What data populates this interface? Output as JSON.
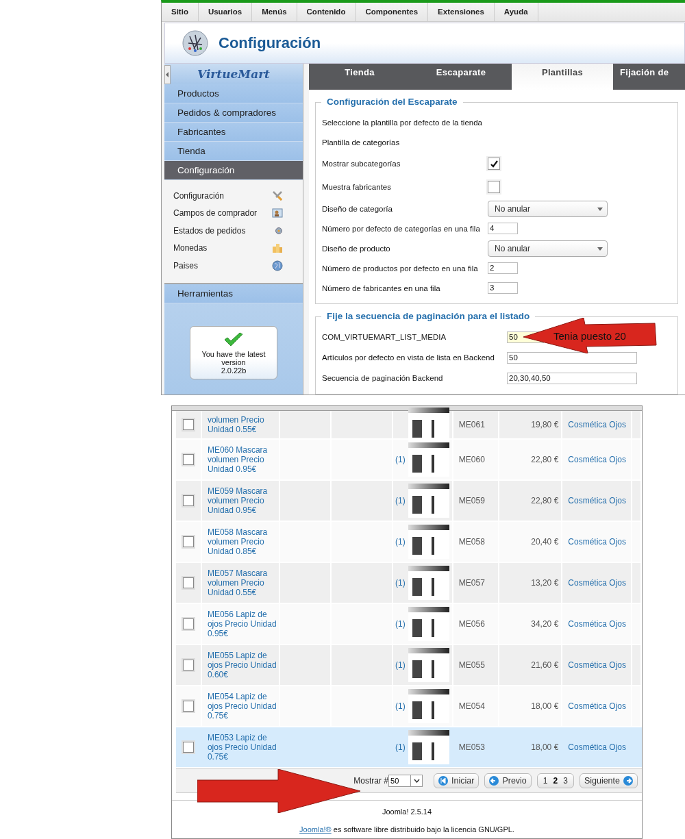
{
  "top_menu": [
    {
      "label": "Sitio"
    },
    {
      "label": "Usuarios"
    },
    {
      "label": "Menús"
    },
    {
      "label": "Contenido"
    },
    {
      "label": "Componentes"
    },
    {
      "label": "Extensiones"
    },
    {
      "label": "Ayuda"
    }
  ],
  "header": {
    "title": "Configuración"
  },
  "sidebar": {
    "logo": "VirtueMart",
    "sections": [
      {
        "label": "Productos",
        "selected": false
      },
      {
        "label": "Pedidos & compradores",
        "selected": false
      },
      {
        "label": "Fabricantes",
        "selected": false
      },
      {
        "label": "Tienda",
        "selected": false
      },
      {
        "label": "Configuración",
        "selected": true
      }
    ],
    "subitems": [
      {
        "label": "Configuración"
      },
      {
        "label": "Campos de comprador"
      },
      {
        "label": "Estados de pedidos"
      },
      {
        "label": "Monedas"
      },
      {
        "label": "Paises"
      }
    ],
    "tools": {
      "label": "Herramientas"
    },
    "version_box": {
      "message": "You have the latest version",
      "version": "2.0.22b"
    }
  },
  "tabs": [
    {
      "label": "Tienda",
      "selected": false
    },
    {
      "label": "Escaparate",
      "selected": false
    },
    {
      "label": "Plantillas",
      "selected": true
    },
    {
      "label": "Fijación de",
      "selected": false
    }
  ],
  "fieldsets": [
    {
      "legend": "Configuración del Escaparate",
      "rows": [
        {
          "kind": "text",
          "label": "Seleccione la plantilla por defecto de la tienda"
        },
        {
          "kind": "text",
          "label": "Plantilla de categorías"
        },
        {
          "kind": "checkbox",
          "label": "Mostrar subcategorías",
          "checked": true
        },
        {
          "kind": "checkbox",
          "label": "Muestra fabricantes",
          "checked": false
        },
        {
          "kind": "select",
          "label": "Diseño de categoría",
          "value": "No anular"
        },
        {
          "kind": "input",
          "label": "Número por defecto de categorías en una fila",
          "value": "4"
        },
        {
          "kind": "select",
          "label": "Diseño de producto",
          "value": "No anular"
        },
        {
          "kind": "input",
          "label": "Número de productos por defecto en una fila",
          "value": "2"
        },
        {
          "kind": "input",
          "label": "Número de fabricantes en una fila",
          "value": "3"
        }
      ]
    },
    {
      "legend": "Fije la secuencia de paginación para el listado",
      "rows": [
        {
          "kind": "input",
          "label": "COM_VIRTUEMART_LIST_MEDIA",
          "value": "50",
          "focused": true
        },
        {
          "kind": "input",
          "label": "Artículos por defecto en vista de lista en Backend",
          "value": "50",
          "focused": false
        },
        {
          "kind": "input",
          "label": "Secuencia de paginación Backend",
          "value": "20,30,40,50",
          "focused": false
        }
      ]
    }
  ],
  "annotation": {
    "text": "Tenia puesto 20"
  },
  "products": [
    {
      "name": "volumen Precio Unidad 0.55€",
      "sku": "ME061",
      "price": "19,80 €",
      "category": "Cosmética Ojos",
      "highlighted": false
    },
    {
      "name": "ME060 Mascara volumen Precio Unidad 0.95€",
      "media_count": "(1)",
      "sku": "ME060",
      "price": "22,80 €",
      "category": "Cosmética Ojos",
      "highlighted": false
    },
    {
      "name": "ME059 Mascara volumen Precio Unidad 0.95€",
      "media_count": "(1)",
      "sku": "ME059",
      "price": "22,80 €",
      "category": "Cosmética Ojos",
      "highlighted": false
    },
    {
      "name": "ME058 Mascara volumen Precio Unidad 0.85€",
      "media_count": "(1)",
      "sku": "ME058",
      "price": "20,40 €",
      "category": "Cosmética Ojos",
      "highlighted": false
    },
    {
      "name": "ME057 Mascara volumen Precio Unidad 0.55€",
      "media_count": "(1)",
      "sku": "ME057",
      "price": "13,20 €",
      "category": "Cosmética Ojos",
      "highlighted": false
    },
    {
      "name": "ME056 Lapiz de ojos Precio Unidad 0.95€",
      "media_count": "(1)",
      "sku": "ME056",
      "price": "34,20 €",
      "category": "Cosmética Ojos",
      "highlighted": false
    },
    {
      "name": "ME055 Lapiz de ojos Precio Unidad 0.60€",
      "media_count": "(1)",
      "sku": "ME055",
      "price": "21,60 €",
      "category": "Cosmética Ojos",
      "highlighted": false
    },
    {
      "name": "ME054 Lapiz de ojos Precio Unidad 0.75€",
      "media_count": "(1)",
      "sku": "ME054",
      "price": "18,00 €",
      "category": "Cosmética Ojos",
      "highlighted": false
    },
    {
      "name": "ME053 Lapiz de ojos Precio Unidad 0.75€",
      "media_count": "(1)",
      "sku": "ME053",
      "price": "18,00 €",
      "category": "Cosmética Ojos",
      "highlighted": true
    }
  ],
  "pagination": {
    "label": "Mostrar #",
    "value": "50",
    "first": "Iniciar",
    "prev": "Previo",
    "pages": [
      {
        "label": "1",
        "selected": false
      },
      {
        "label": "2",
        "selected": true
      },
      {
        "label": "3",
        "selected": false
      }
    ],
    "next": "Siguiente"
  },
  "footer": {
    "version": "Joomla! 2.5.14",
    "license_link": "Joomla!®",
    "license_text": "es software libre distribuido bajo la licencia GNU/GPL."
  }
}
